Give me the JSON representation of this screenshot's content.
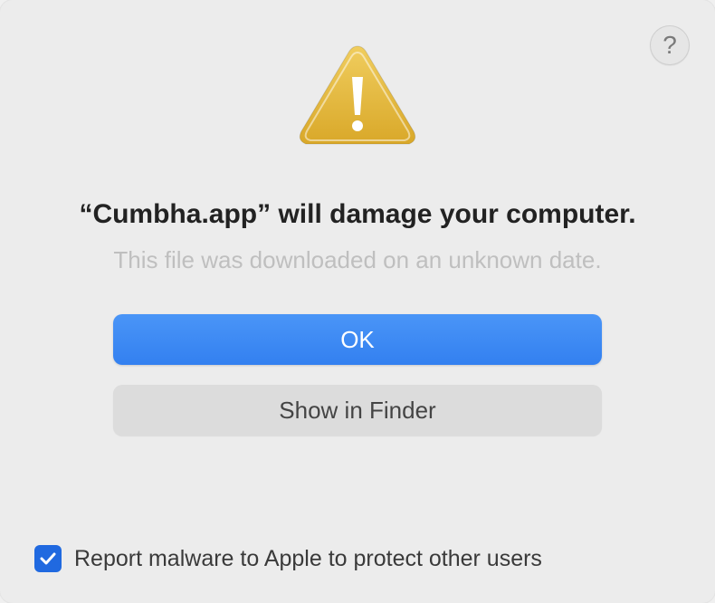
{
  "dialog": {
    "heading": "“Cumbha.app” will damage your computer.",
    "subtext": "This file was downloaded on an unknown date.",
    "buttons": {
      "ok": "OK",
      "show_in_finder": "Show in Finder"
    },
    "help_label": "?",
    "checkbox": {
      "checked": true,
      "label": "Report malware to Apple to protect other users"
    }
  }
}
